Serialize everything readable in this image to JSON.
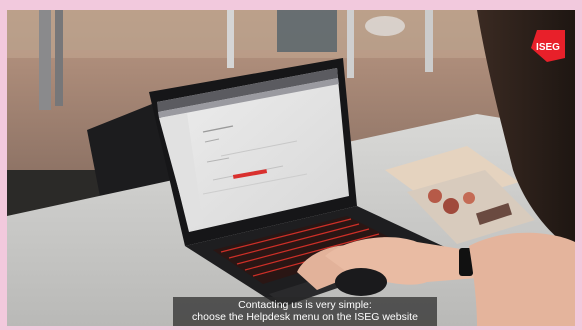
{
  "video": {
    "subtitle_line1": "Contacting us is very simple:",
    "subtitle_line2": "choose the Helpdesk menu on the ISEG website"
  },
  "logo": {
    "text": "ISEG",
    "color": "#e8202a"
  },
  "colors": {
    "frame_border": "#f2c9dd",
    "keyboard_backlight": "#e0322a",
    "table": "#cfcfcf",
    "wall": "#b89a80"
  }
}
